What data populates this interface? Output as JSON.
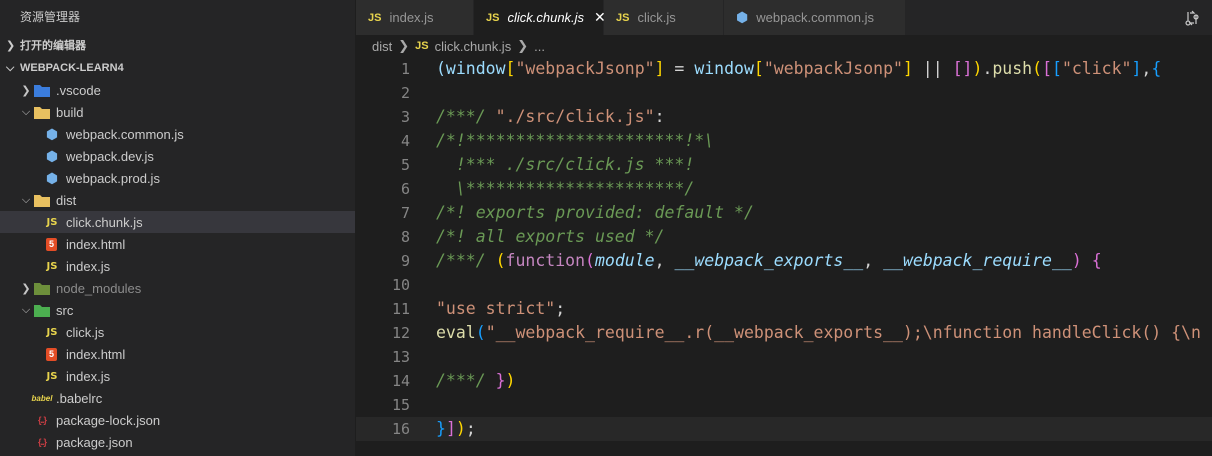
{
  "explorer": {
    "title": "资源管理器",
    "open_editors": "打开的编辑器",
    "project": "WEBPACK-LEARN4",
    "tree": [
      {
        "label": ".vscode",
        "type": "folder",
        "depth": 1,
        "twist": ">"
      },
      {
        "label": "build",
        "type": "folder",
        "depth": 1,
        "twist": "v"
      },
      {
        "label": "webpack.common.js",
        "type": "config",
        "depth": 2
      },
      {
        "label": "webpack.dev.js",
        "type": "config",
        "depth": 2
      },
      {
        "label": "webpack.prod.js",
        "type": "config",
        "depth": 2
      },
      {
        "label": "dist",
        "type": "folder",
        "depth": 1,
        "twist": "v"
      },
      {
        "label": "click.chunk.js",
        "type": "js",
        "depth": 2,
        "selected": true
      },
      {
        "label": "index.html",
        "type": "html",
        "depth": 2
      },
      {
        "label": "index.js",
        "type": "js",
        "depth": 2
      },
      {
        "label": "node_modules",
        "type": "folder",
        "depth": 1,
        "twist": ">",
        "dim": true
      },
      {
        "label": "src",
        "type": "folder",
        "depth": 1,
        "twist": "v"
      },
      {
        "label": "click.js",
        "type": "js",
        "depth": 2
      },
      {
        "label": "index.html",
        "type": "html",
        "depth": 2
      },
      {
        "label": "index.js",
        "type": "js",
        "depth": 2
      },
      {
        "label": ".babelrc",
        "type": "babel",
        "depth": 1
      },
      {
        "label": "package-lock.json",
        "type": "json",
        "depth": 1
      },
      {
        "label": "package.json",
        "type": "json",
        "depth": 1
      }
    ]
  },
  "tabs": [
    {
      "label": "index.js",
      "icon": "JS",
      "active": false
    },
    {
      "label": "click.chunk.js",
      "icon": "JS",
      "active": true
    },
    {
      "label": "click.js",
      "icon": "JS",
      "active": false
    },
    {
      "label": "webpack.common.js",
      "icon": "hex",
      "active": false
    }
  ],
  "breadcrumb": {
    "folder": "dist",
    "icon": "JS",
    "file": "click.chunk.js",
    "more": "..."
  },
  "editor": {
    "current_line": 16,
    "lines": [
      {
        "n": "1",
        "html": "<span class='c-var'>(window</span><span class='c-b1'>[</span><span class='c-str'>\"webpackJsonp\"</span><span class='c-b1'>]</span> = <span class='c-var'>window</span><span class='c-b1'>[</span><span class='c-str'>\"webpackJsonp\"</span><span class='c-b1'>]</span> || <span class='c-b2'>[]</span><span class='c-b1'>)</span>.<span class='c-fn'>push</span><span class='c-b1'>(</span><span class='c-b2'>[</span><span class='c-b3'>[</span><span class='c-str'>\"click\"</span><span class='c-b3'>]</span>,<span class='c-b3'>{</span>"
      },
      {
        "n": "2",
        "html": ""
      },
      {
        "n": "3",
        "html": "<span class='c-cm'>/***/</span> <span class='c-str'>\"./src/click.js\"</span>:"
      },
      {
        "n": "4",
        "html": "<span class='c-cm'>/*!**********************!*\\</span>"
      },
      {
        "n": "5",
        "html": "<span class='c-cm'>  !*** ./src/click.js ***!</span>"
      },
      {
        "n": "6",
        "html": "<span class='c-cm'>  \\**********************/</span>"
      },
      {
        "n": "7",
        "html": "<span class='c-cm'>/*! exports provided: default */</span>"
      },
      {
        "n": "8",
        "html": "<span class='c-cm'>/*! all exports used */</span>"
      },
      {
        "n": "9",
        "html": "<span class='c-cm'>/***/</span> <span class='c-b1'>(</span><span class='c-kw'>function</span><span class='c-b2'>(</span><span class='c-param'>module</span>, <span class='c-param'>__webpack_exports__</span>, <span class='c-param'>__webpack_require__</span><span class='c-b2'>)</span> <span class='c-b2'>{</span>"
      },
      {
        "n": "10",
        "html": ""
      },
      {
        "n": "11",
        "html": "<span class='c-str'>\"use strict\"</span>;"
      },
      {
        "n": "12",
        "html": "<span class='c-fn'>eval</span><span class='c-b3'>(</span><span class='c-str'>\"__webpack_require__.r(__webpack_exports__);\\nfunction handleClick() {\\n</span>"
      },
      {
        "n": "13",
        "html": ""
      },
      {
        "n": "14",
        "html": "<span class='c-cm'>/***/</span> <span class='c-b2'>}</span><span class='c-b1'>)</span>"
      },
      {
        "n": "15",
        "html": ""
      },
      {
        "n": "16",
        "html": "<span class='c-b3'>}</span><span class='c-b2'>]</span><span class='c-b1'>)</span>;"
      }
    ]
  }
}
